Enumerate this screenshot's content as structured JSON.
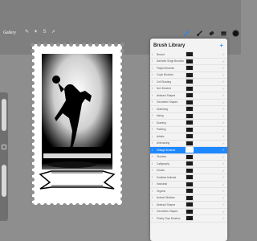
{
  "toolbar": {
    "gallery_label": "Gallery"
  },
  "brush_panel": {
    "title": "Brush Library",
    "add_label": "+",
    "categories": [
      {
        "label": "Recent",
        "selected": false
      },
      {
        "label": "Narinder Singh Brushes",
        "selected": false
      },
      {
        "label": "Playful Brushes",
        "selected": false
      },
      {
        "label": "Copic Brushes",
        "selected": false
      },
      {
        "label": "Cell Shading",
        "selected": false
      },
      {
        "label": "Noir Brushes",
        "selected": false
      },
      {
        "label": "Abstract Shapes",
        "selected": false
      },
      {
        "label": "Geometric Shapes",
        "selected": false
      },
      {
        "label": "Sketching",
        "selected": false
      },
      {
        "label": "Inking",
        "selected": false
      },
      {
        "label": "Drawing",
        "selected": false
      },
      {
        "label": "Painting",
        "selected": false
      },
      {
        "label": "Artistic",
        "selected": false
      },
      {
        "label": "Airbrushing",
        "selected": false
      },
      {
        "label": "Vintage Brushes",
        "selected": true
      },
      {
        "label": "Textures",
        "selected": false
      },
      {
        "label": "Calligraphy",
        "selected": false
      },
      {
        "label": "Clouds",
        "selected": false
      },
      {
        "label": "Zombies Animals",
        "selected": false
      },
      {
        "label": "Industrial",
        "selected": false
      },
      {
        "label": "Organic",
        "selected": false
      },
      {
        "label": "Animal Skeleton",
        "selected": false
      },
      {
        "label": "Abstract Shapes",
        "selected": false
      },
      {
        "label": "Geometric Shapes",
        "selected": false
      },
      {
        "label": "Plushy Toys Brushes",
        "selected": false
      }
    ],
    "brushes": [
      {
        "selected": false
      },
      {
        "selected": false
      },
      {
        "selected": false
      },
      {
        "selected": false
      },
      {
        "selected": false
      },
      {
        "selected": false
      },
      {
        "selected": false
      },
      {
        "selected": false
      },
      {
        "selected": false
      },
      {
        "selected": false
      },
      {
        "selected": false
      },
      {
        "selected": false
      },
      {
        "selected": false
      },
      {
        "selected": false
      },
      {
        "selected": true
      },
      {
        "selected": false
      },
      {
        "selected": false
      },
      {
        "selected": false
      },
      {
        "selected": false
      },
      {
        "selected": false
      },
      {
        "selected": false
      },
      {
        "selected": false
      },
      {
        "selected": false
      },
      {
        "selected": false
      },
      {
        "selected": false
      }
    ]
  },
  "colors": {
    "accent": "#1e88ff",
    "current_color": "#111111"
  }
}
